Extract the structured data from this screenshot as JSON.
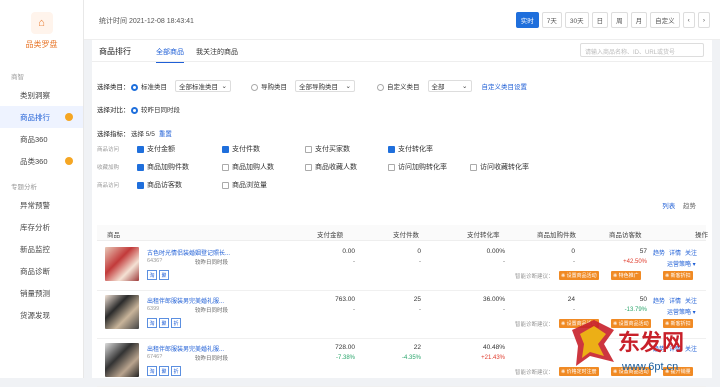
{
  "sidebar": {
    "logo_glyph": "⌂",
    "title": "品类罗盘",
    "groups": [
      {
        "label": "商智",
        "items": [
          {
            "label": "类别洞察",
            "active": false,
            "dot": false
          },
          {
            "label": "商品排行",
            "active": true,
            "dot": true
          },
          {
            "label": "商品360",
            "active": false,
            "dot": false
          },
          {
            "label": "品类360",
            "active": false,
            "dot": true
          }
        ]
      },
      {
        "label": "专题分析",
        "items": [
          {
            "label": "异常预警",
            "active": false,
            "dot": false
          },
          {
            "label": "库存分析",
            "active": false,
            "dot": false
          },
          {
            "label": "新品监控",
            "active": false,
            "dot": false
          },
          {
            "label": "商品诊断",
            "active": false,
            "dot": false
          },
          {
            "label": "销量预测",
            "active": false,
            "dot": false
          },
          {
            "label": "货源发现",
            "active": false,
            "dot": false
          }
        ]
      }
    ]
  },
  "topbar": {
    "stat_time": "统计时间 2021-12-08 18:43:41",
    "buttons": [
      "实时",
      "7天",
      "30天",
      "日",
      "周",
      "月",
      "自定义"
    ],
    "active_index": 0,
    "prev": "‹",
    "next": "›"
  },
  "main": {
    "title": "商品排行",
    "tabs": [
      "全部商品",
      "我关注的商品"
    ],
    "search_placeholder": "请输入商品名称、ID、URL或货号",
    "filter": {
      "category_label": "选择类目：",
      "std_label": "标准类目",
      "std_value": "全部标准类目",
      "shop_label": "导购类目",
      "shop_value": "全部导购类目",
      "custom_label": "自定义类目",
      "custom_value": "全部",
      "custom_link": "自定义类目设置",
      "compare_label": "选择对比：",
      "compare_value": "较昨日同时段",
      "metric_label": "选择指标：",
      "metric_count": "选择 5/5",
      "metric_reset": "重置"
    },
    "metric_groups": [
      {
        "cat": "商品访问",
        "items": [
          {
            "label": "支付金额",
            "on": true
          },
          {
            "label": "支付件数",
            "on": true
          },
          {
            "label": "支付买家数",
            "on": false
          },
          {
            "label": "支付转化率",
            "on": true
          }
        ]
      },
      {
        "cat": "收藏加购",
        "items": [
          {
            "label": "商品加购件数",
            "on": true
          },
          {
            "label": "商品加购人数",
            "on": false
          },
          {
            "label": "商品收藏人数",
            "on": false
          },
          {
            "label": "访问加购转化率",
            "on": false
          },
          {
            "label": "访问收藏转化率",
            "on": false
          }
        ]
      },
      {
        "cat": "商品访问",
        "items": [
          {
            "label": "商品访客数",
            "on": true
          },
          {
            "label": "商品浏览量",
            "on": false
          }
        ]
      }
    ],
    "view_links": [
      "列表",
      "趋势"
    ],
    "table": {
      "headers": [
        "商品",
        "支付金额",
        "支付件数",
        "支付转化率",
        "商品加购件数",
        "商品访客数",
        "操作"
      ],
      "rows": [
        {
          "name": "古色时光情侣装婚姻登记照长...",
          "id": "6436?",
          "time": "较昨日同时段",
          "tags": [
            "淘",
            "聚"
          ],
          "amount": "0.00",
          "amount_sub": "-",
          "count": "0",
          "count_sub": "-",
          "conv": "0.00%",
          "conv_sub": "-",
          "cart": "0",
          "cart_sub": "-",
          "visitors": "57",
          "visitors_sub": "+42.50%",
          "visitors_tone": "red",
          "actions": [
            "趋势",
            "详情",
            "关注"
          ],
          "more": "运营策略 ▾",
          "diag": "智能诊断建议：",
          "tips": [
            "设置商品活动",
            "特色推广",
            "新客折扣"
          ]
        },
        {
          "name": "出租伴郎服装男完美婚礼服...",
          "id": "6399",
          "time": "较昨日同时段",
          "tags": [
            "淘",
            "聚",
            "折"
          ],
          "amount": "763.00",
          "amount_sub": "-",
          "count": "25",
          "count_sub": "-",
          "conv": "36.00%",
          "conv_sub": "-",
          "cart": "24",
          "cart_sub": "-",
          "visitors": "50",
          "visitors_sub": "-13.79%",
          "visitors_tone": "green",
          "actions": [
            "趋势",
            "详情",
            "关注"
          ],
          "more": "运营策略 ▾",
          "diag": "智能诊断建议：",
          "tips": [
            "设置商品活动",
            "设置商品活动",
            "新客折扣"
          ]
        },
        {
          "name": "出租伴郎服装男完美婚礼服...",
          "id": "6746?",
          "time": "较昨日同时段",
          "tags": [
            "淘",
            "聚",
            "折"
          ],
          "amount": "728.00",
          "amount_sub": "-7.38%",
          "amount_tone": "green",
          "count": "22",
          "count_sub": "-4.35%",
          "count_tone": "green",
          "conv": "40.48%",
          "conv_sub": "+21.43%",
          "conv_tone": "red",
          "cart": "",
          "cart_sub": "",
          "visitors": "",
          "visitors_sub": "",
          "actions": [
            "趋势",
            "详情",
            "关注"
          ],
          "more": "",
          "diag": "智能诊断建议：",
          "tips": [
            "价格定时注册",
            "设置商品活动",
            "提升销量"
          ]
        }
      ]
    }
  },
  "watermark": {
    "text": "东发网",
    "url": "www.6pt.cn"
  },
  "colors": {
    "primary": "#1f6fdc",
    "orange": "#f08a24",
    "red": "#e03b2c",
    "green": "#2aa56b"
  }
}
